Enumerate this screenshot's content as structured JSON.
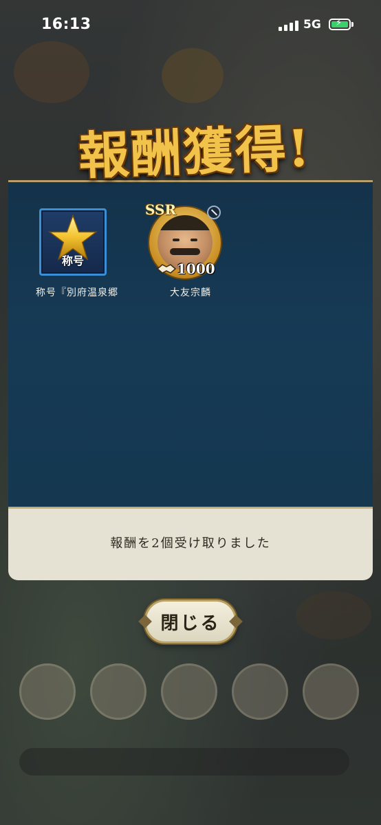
{
  "status_bar": {
    "time": "16:13",
    "network": "5G",
    "battery_charging": true
  },
  "dialog": {
    "title": "報酬獲得!",
    "rewards": [
      {
        "icon": "star-icon",
        "icon_tag": "称号",
        "label": "称号『別府温泉郷"
      },
      {
        "icon": "character-portrait",
        "rarity": "SSR",
        "count": "1000",
        "label": "大友宗麟"
      }
    ],
    "message": "報酬を2個受け取りました",
    "close_label": "閉じる"
  },
  "colors": {
    "panel": "#163a55",
    "title_gold": "#f2c34a",
    "frame_gold": "#b9a06a",
    "message_bg": "#e6e2d3"
  }
}
